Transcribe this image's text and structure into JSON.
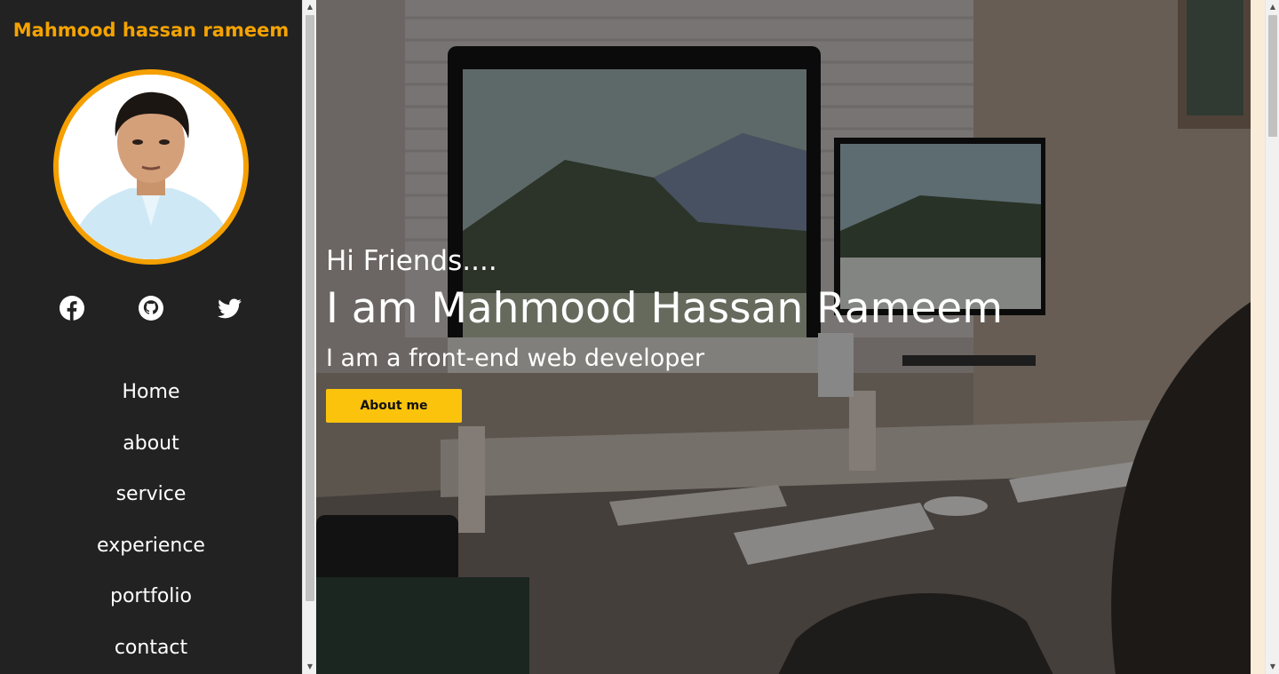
{
  "sidebar": {
    "brand": "Mahmood hassan rameem",
    "socials": [
      {
        "name": "facebook"
      },
      {
        "name": "github"
      },
      {
        "name": "twitter"
      }
    ],
    "nav": [
      {
        "label": "Home"
      },
      {
        "label": "about"
      },
      {
        "label": "service"
      },
      {
        "label": "experience"
      },
      {
        "label": "portfolio"
      },
      {
        "label": "contact"
      }
    ]
  },
  "hero": {
    "greeting": "Hi Friends....",
    "headline": "I am Mahmood Hassan Rameem",
    "tagline": "I am a front-end web developer",
    "button_label": "About me"
  },
  "colors": {
    "accent": "#f5a300",
    "button": "#fbc30c",
    "sidebar_bg": "#222222"
  },
  "icons": {
    "facebook": "facebook-icon",
    "github": "github-icon",
    "twitter": "twitter-icon"
  }
}
